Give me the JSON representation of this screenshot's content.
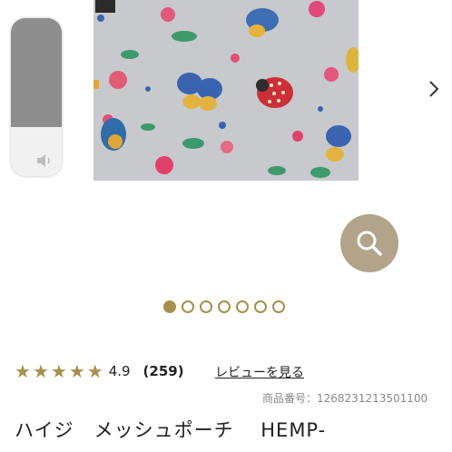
{
  "gallery": {
    "pager_count": 7,
    "active_index": 0,
    "accent_color": "#a7904b"
  },
  "product": {
    "rating_value": "4.9",
    "review_count": "(259)",
    "review_link": "レビューを見る",
    "product_number": "商品番号：1268231213501100",
    "title": "ハイジ　メッシュポーチ　 HEMP-"
  },
  "icons": {
    "next": "chevron-right-icon",
    "volume": "speaker-icon",
    "zoom": "magnifier-icon",
    "stars": "star-icon"
  }
}
